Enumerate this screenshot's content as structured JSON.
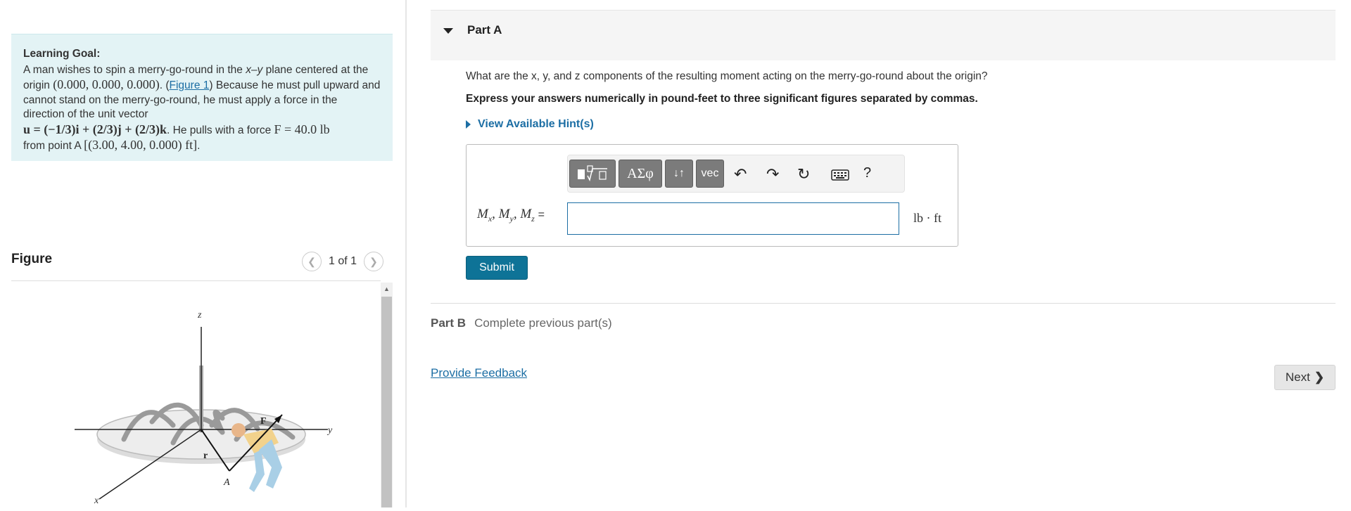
{
  "learning_goal": {
    "heading": "Learning Goal:",
    "intro": "A man wishes to spin a merry-go-round in the",
    "plane": "x–y",
    "centered": "plane centered at the origin",
    "origin": "(0.000, 0.000, 0.000)",
    "figure_link": "Figure 1",
    "body": "Because he must pull upward and cannot stand on the merry-go-round, he must apply a force in the direction of the unit vector",
    "unit_vector": "u = (−1/3)i + (2/3)j + (2/3)k",
    "pulls": "He pulls with a force",
    "force": "F = 40.0 lb",
    "from_point": "from point A",
    "point_a": "[(3.00, 4.00, 0.000) ft]"
  },
  "figure": {
    "title": "Figure",
    "pager": "1 of 1",
    "labels": {
      "z": "z",
      "y": "y",
      "x": "x",
      "F": "F",
      "r": "r",
      "A": "A"
    }
  },
  "partA": {
    "title": "Part A",
    "question": "What are the x, y, and z components of the resulting moment acting on the merry-go-round about the origin?",
    "instruction": "Express your answers numerically in pound-feet to three significant figures separated by commas.",
    "hints": "View Available Hint(s)",
    "toolbar": {
      "greek": "ΑΣφ",
      "arrows": "↓↑",
      "vec": "vec",
      "help": "?"
    },
    "label": "Mx, My, Mz",
    "input_value": "",
    "unit": "lb · ft",
    "submit": "Submit"
  },
  "partB": {
    "label": "Part B",
    "status": "Complete previous part(s)"
  },
  "feedback": "Provide Feedback",
  "next": "Next"
}
